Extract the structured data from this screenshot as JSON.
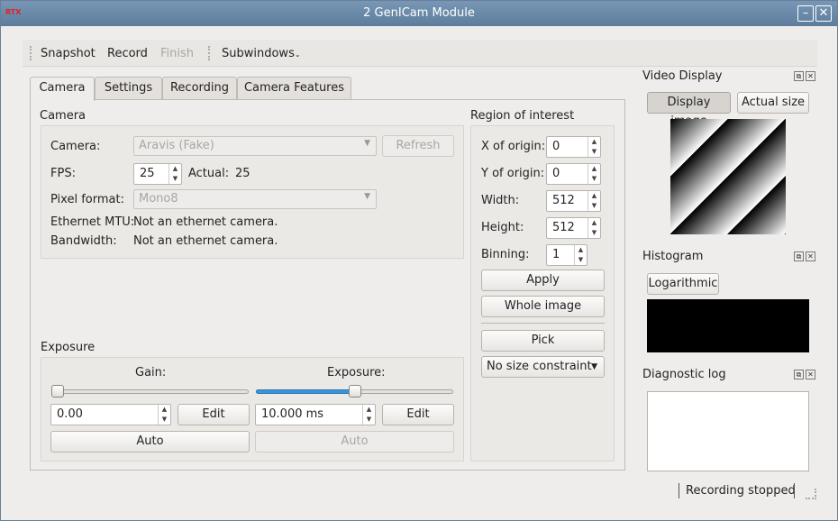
{
  "window": {
    "title": "2 GenICam Module",
    "app_icon": "RTX"
  },
  "toolbar": {
    "snapshot": "Snapshot",
    "record": "Record",
    "finish": "Finish",
    "subwindows": "Subwindows"
  },
  "tabs": [
    "Camera",
    "Settings",
    "Recording",
    "Camera Features"
  ],
  "camera": {
    "heading": "Camera",
    "camera_label": "Camera:",
    "camera_value": "Aravis (Fake)",
    "refresh": "Refresh",
    "fps_label": "FPS:",
    "fps_value": "25",
    "actual_label": "Actual:",
    "actual_value": "25",
    "pixel_label": "Pixel format:",
    "pixel_value": "Mono8",
    "mtu_label": "Ethernet MTU:",
    "mtu_value": "Not an ethernet camera.",
    "bw_label": "Bandwidth:",
    "bw_value": "Not an ethernet camera."
  },
  "exposure": {
    "heading": "Exposure",
    "gain_label": "Gain:",
    "gain_value": "0.00",
    "gain_edit": "Edit",
    "gain_auto": "Auto",
    "gain_level": 0,
    "exp_label": "Exposure:",
    "exp_value": "10.000 ms",
    "exp_edit": "Edit",
    "exp_auto": "Auto",
    "exp_level": 0.5
  },
  "roi": {
    "heading": "Region of interest",
    "x_label": "X of origin:",
    "x_value": "0",
    "y_label": "Y of origin:",
    "y_value": "0",
    "w_label": "Width:",
    "w_value": "512",
    "h_label": "Height:",
    "h_value": "512",
    "bin_label": "Binning:",
    "bin_value": "1",
    "apply": "Apply",
    "whole": "Whole image",
    "pick": "Pick",
    "constraint": "No size constraint"
  },
  "video": {
    "title": "Video Display",
    "display": "Display image",
    "actual_size": "Actual size"
  },
  "histogram": {
    "title": "Histogram",
    "log": "Logarithmic"
  },
  "diag": {
    "title": "Diagnostic log"
  },
  "status": {
    "text": "Recording stopped"
  }
}
